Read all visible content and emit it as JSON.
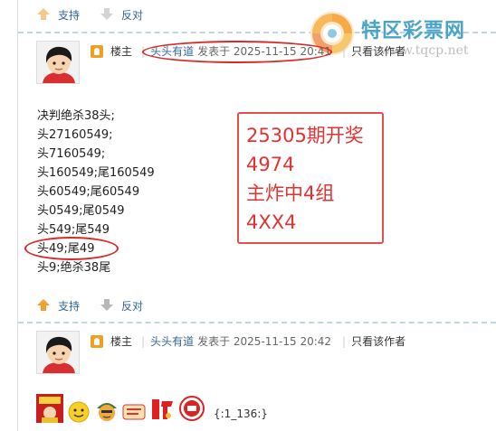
{
  "votes": {
    "support_label": "支持",
    "oppose_label": "反对"
  },
  "watermark": {
    "title": "特区彩票网",
    "url": "www.tqcp.net"
  },
  "posts": [
    {
      "role": "楼主",
      "author": "头头有道",
      "posted_at": "发表于 2025-11-15 20:41",
      "only_author": "只看该作者",
      "lines": [
        "决判绝杀38头;",
        "头27160549;",
        "头7160549;",
        "头160549;尾160549",
        "头60549;尾60549",
        "头0549;尾0549",
        "头549;尾549",
        "头49;尾49",
        "头9;绝杀38尾"
      ],
      "highlight": [
        "25305期开奖",
        "4974",
        "主炸中4组",
        "4XX4"
      ]
    },
    {
      "role": "楼主",
      "author": "头头有道",
      "posted_at": "发表于 2025-11-15 20:42",
      "only_author": "只看该作者",
      "emoticon_text": "{:1_136:}"
    }
  ],
  "colors": {
    "link": "#336699",
    "highlight_red": "#e23232",
    "annotation_red": "#d92a2a",
    "support_arrow": "#f0a030"
  }
}
